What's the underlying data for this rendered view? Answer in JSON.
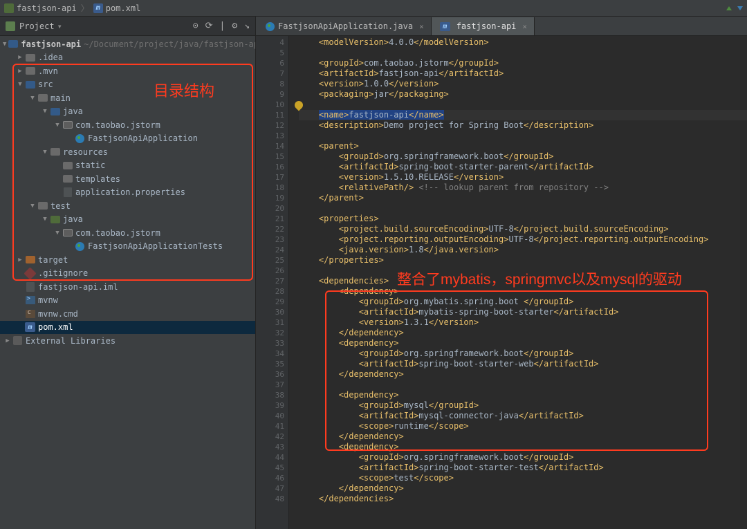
{
  "breadcrumb": {
    "project": "fastjson-api",
    "file": "pom.xml"
  },
  "sidebar": {
    "title": "Project",
    "tools": [
      "⊙",
      "⟳",
      "|",
      "⚙",
      "↘"
    ],
    "root": {
      "name": "fastjson-api",
      "path": "~/Document/project/java/fastjson-ap"
    },
    "items": [
      {
        "d": 1,
        "a": "r",
        "k": "folder",
        "n": ".idea"
      },
      {
        "d": 1,
        "a": "r",
        "k": "folder",
        "n": ".mvn"
      },
      {
        "d": 1,
        "a": "d",
        "k": "folder-bl",
        "n": "src"
      },
      {
        "d": 2,
        "a": "d",
        "k": "folder",
        "n": "main"
      },
      {
        "d": 3,
        "a": "d",
        "k": "folder-bl",
        "n": "java"
      },
      {
        "d": 4,
        "a": "d",
        "k": "pkg",
        "n": "com.taobao.jstorm"
      },
      {
        "d": 5,
        "a": " ",
        "k": "java",
        "n": "FastjsonApiApplication"
      },
      {
        "d": 3,
        "a": "d",
        "k": "folder",
        "n": "resources"
      },
      {
        "d": 4,
        "a": " ",
        "k": "folder",
        "n": "static"
      },
      {
        "d": 4,
        "a": " ",
        "k": "folder",
        "n": "templates"
      },
      {
        "d": 4,
        "a": " ",
        "k": "file",
        "n": "application.properties"
      },
      {
        "d": 2,
        "a": "d",
        "k": "folder",
        "n": "test"
      },
      {
        "d": 3,
        "a": "d",
        "k": "folder-gr",
        "n": "java"
      },
      {
        "d": 4,
        "a": "d",
        "k": "pkg",
        "n": "com.taobao.jstorm"
      },
      {
        "d": 5,
        "a": " ",
        "k": "java",
        "n": "FastjsonApiApplicationTests"
      },
      {
        "d": 1,
        "a": "r",
        "k": "folder-or",
        "n": "target"
      },
      {
        "d": 1,
        "a": " ",
        "k": "git",
        "n": ".gitignore"
      },
      {
        "d": 1,
        "a": " ",
        "k": "file",
        "n": "fastjson-api.iml"
      },
      {
        "d": 1,
        "a": " ",
        "k": "sh",
        "n": "mvnw"
      },
      {
        "d": 1,
        "a": " ",
        "k": "cmd",
        "n": "mvnw.cmd"
      },
      {
        "d": 1,
        "a": " ",
        "k": "m",
        "n": "pom.xml",
        "sel": true
      },
      {
        "d": 0,
        "a": "r",
        "k": "lib",
        "n": "External Libraries"
      }
    ]
  },
  "tabs": [
    {
      "k": "java",
      "label": "FastjsonApiApplication.java",
      "active": false
    },
    {
      "k": "m",
      "label": "fastjson-api",
      "active": true
    }
  ],
  "annotations": {
    "tree": "目录结构",
    "deps": "整合了mybatis，springmvc以及mysql的驱动"
  },
  "code": {
    "startLine": 4,
    "lines": [
      [
        [
          "    ",
          ""
        ],
        [
          "<modelVersion>",
          "t"
        ],
        [
          "4.0.0",
          ""
        ],
        [
          "</modelVersion>",
          "t"
        ]
      ],
      [],
      [
        [
          "    ",
          ""
        ],
        [
          "<groupId>",
          "t"
        ],
        [
          "com.taobao.jstorm",
          ""
        ],
        [
          "</groupId>",
          "t"
        ]
      ],
      [
        [
          "    ",
          ""
        ],
        [
          "<artifactId>",
          "t"
        ],
        [
          "fastjson-api",
          ""
        ],
        [
          "</artifactId>",
          "t"
        ]
      ],
      [
        [
          "    ",
          ""
        ],
        [
          "<version>",
          "t"
        ],
        [
          "1.0.0",
          ""
        ],
        [
          "</version>",
          "t"
        ]
      ],
      [
        [
          "    ",
          ""
        ],
        [
          "<packaging>",
          "t"
        ],
        [
          "jar",
          ""
        ],
        [
          "</packaging>",
          "t"
        ]
      ],
      [],
      [
        [
          "    ",
          ""
        ],
        [
          "<name>",
          "t hl"
        ],
        [
          "fastjson-api",
          "hl"
        ],
        [
          "</name>",
          "t hl"
        ]
      ],
      [
        [
          "    ",
          ""
        ],
        [
          "<description>",
          "t"
        ],
        [
          "Demo project for Spring Boot",
          ""
        ],
        [
          "</description>",
          "t"
        ]
      ],
      [],
      [
        [
          "    ",
          ""
        ],
        [
          "<parent>",
          "t"
        ]
      ],
      [
        [
          "        ",
          ""
        ],
        [
          "<groupId>",
          "t"
        ],
        [
          "org.springframework.boot",
          ""
        ],
        [
          "</groupId>",
          "t"
        ]
      ],
      [
        [
          "        ",
          ""
        ],
        [
          "<artifactId>",
          "t"
        ],
        [
          "spring-boot-starter-parent",
          ""
        ],
        [
          "</artifactId>",
          "t"
        ]
      ],
      [
        [
          "        ",
          ""
        ],
        [
          "<version>",
          "t"
        ],
        [
          "1.5.10.RELEASE",
          ""
        ],
        [
          "</version>",
          "t"
        ]
      ],
      [
        [
          "        ",
          ""
        ],
        [
          "<relativePath/>",
          "t"
        ],
        [
          " <!-- lookup parent from repository -->",
          "c"
        ]
      ],
      [
        [
          "    ",
          ""
        ],
        [
          "</parent>",
          "t"
        ]
      ],
      [],
      [
        [
          "    ",
          ""
        ],
        [
          "<properties>",
          "t"
        ]
      ],
      [
        [
          "        ",
          ""
        ],
        [
          "<project.build.sourceEncoding>",
          "t"
        ],
        [
          "UTF-8",
          ""
        ],
        [
          "</project.build.sourceEncoding>",
          "t"
        ]
      ],
      [
        [
          "        ",
          ""
        ],
        [
          "<project.reporting.outputEncoding>",
          "t"
        ],
        [
          "UTF-8",
          ""
        ],
        [
          "</project.reporting.outputEncoding>",
          "t"
        ]
      ],
      [
        [
          "        ",
          ""
        ],
        [
          "<java.version>",
          "t"
        ],
        [
          "1.8",
          ""
        ],
        [
          "</java.version>",
          "t"
        ]
      ],
      [
        [
          "    ",
          ""
        ],
        [
          "</properties>",
          "t"
        ]
      ],
      [],
      [
        [
          "    ",
          ""
        ],
        [
          "<dependencies>",
          "t"
        ]
      ],
      [
        [
          "        ",
          ""
        ],
        [
          "<dependency>",
          "t"
        ]
      ],
      [
        [
          "            ",
          ""
        ],
        [
          "<groupId>",
          "t"
        ],
        [
          "org.mybatis.spring.boot",
          ""
        ],
        [
          " </groupId>",
          "t"
        ]
      ],
      [
        [
          "            ",
          ""
        ],
        [
          "<artifactId>",
          "t"
        ],
        [
          "mybatis-spring-boot-starter",
          ""
        ],
        [
          "</artifactId>",
          "t"
        ]
      ],
      [
        [
          "            ",
          ""
        ],
        [
          "<version>",
          "t"
        ],
        [
          "1.3.1",
          ""
        ],
        [
          "</version>",
          "t"
        ]
      ],
      [
        [
          "        ",
          ""
        ],
        [
          "</dependency>",
          "t"
        ]
      ],
      [
        [
          "        ",
          ""
        ],
        [
          "<dependency>",
          "t"
        ]
      ],
      [
        [
          "            ",
          ""
        ],
        [
          "<groupId>",
          "t"
        ],
        [
          "org.springframework.boot",
          ""
        ],
        [
          "</groupId>",
          "t"
        ]
      ],
      [
        [
          "            ",
          ""
        ],
        [
          "<artifactId>",
          "t"
        ],
        [
          "spring-boot-starter-web",
          ""
        ],
        [
          "</artifactId>",
          "t"
        ]
      ],
      [
        [
          "        ",
          ""
        ],
        [
          "</dependency>",
          "t"
        ]
      ],
      [],
      [
        [
          "        ",
          ""
        ],
        [
          "<dependency>",
          "t"
        ]
      ],
      [
        [
          "            ",
          ""
        ],
        [
          "<groupId>",
          "t"
        ],
        [
          "mysql",
          ""
        ],
        [
          "</groupId>",
          "t"
        ]
      ],
      [
        [
          "            ",
          ""
        ],
        [
          "<artifactId>",
          "t"
        ],
        [
          "mysql-connector-java",
          ""
        ],
        [
          "</artifactId>",
          "t"
        ]
      ],
      [
        [
          "            ",
          ""
        ],
        [
          "<scope>",
          "t"
        ],
        [
          "runtime",
          ""
        ],
        [
          "</scope>",
          "t"
        ]
      ],
      [
        [
          "        ",
          ""
        ],
        [
          "</dependency>",
          "t"
        ]
      ],
      [
        [
          "        ",
          ""
        ],
        [
          "<dependency>",
          "t"
        ]
      ],
      [
        [
          "            ",
          ""
        ],
        [
          "<groupId>",
          "t"
        ],
        [
          "org.springframework.boot",
          ""
        ],
        [
          "</groupId>",
          "t"
        ]
      ],
      [
        [
          "            ",
          ""
        ],
        [
          "<artifactId>",
          "t"
        ],
        [
          "spring-boot-starter-test",
          ""
        ],
        [
          "</artifactId>",
          "t"
        ]
      ],
      [
        [
          "            ",
          ""
        ],
        [
          "<scope>",
          "t"
        ],
        [
          "test",
          ""
        ],
        [
          "</scope>",
          "t"
        ]
      ],
      [
        [
          "        ",
          ""
        ],
        [
          "</dependency>",
          "t"
        ]
      ],
      [
        [
          "    ",
          ""
        ],
        [
          "</dependencies>",
          "t"
        ]
      ]
    ]
  }
}
